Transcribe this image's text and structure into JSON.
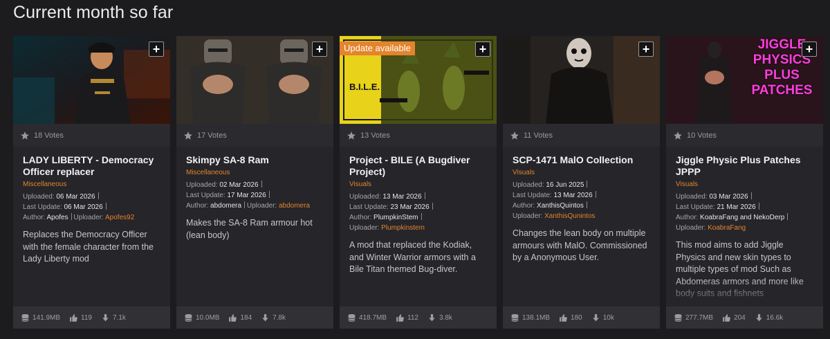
{
  "section": {
    "title": "Current month so far"
  },
  "cards": [
    {
      "votes": "18 Votes",
      "title": "LADY LIBERTY - Democracy Officer replacer",
      "category": "Miscellaneous",
      "uploaded_label": "Uploaded:",
      "uploaded": "06 Mar 2026",
      "updated_label": "Last Update:",
      "updated": "06 Mar 2026",
      "author_label": "Author:",
      "author": "Apofes",
      "uploader_label": "Uploader:",
      "uploader": "Apofes92",
      "description": "Replaces the Democracy Officer with the female character from the Lady Liberty mod",
      "size": "141.9MB",
      "likes": "119",
      "downloads": "7.1k",
      "plus": "+"
    },
    {
      "votes": "17 Votes",
      "title": "Skimpy SA-8 Ram",
      "category": "Miscellaneous",
      "uploaded_label": "Uploaded:",
      "uploaded": "02 Mar 2026",
      "updated_label": "Last Update:",
      "updated": "17 Mar 2026",
      "author_label": "Author:",
      "author": "abdomera",
      "uploader_label": "Uploader:",
      "uploader": "abdomera",
      "description": "Makes the SA-8 Ram armour hot (lean body)",
      "size": "10.0MB",
      "likes": "184",
      "downloads": "7.8k",
      "plus": "+"
    },
    {
      "votes": "13 Votes",
      "badge": "Update available",
      "thumb_text": "B.I.L.E.",
      "title": "Project - BILE (A Bugdiver Project)",
      "category": "Visuals",
      "uploaded_label": "Uploaded:",
      "uploaded": "13 Mar 2026",
      "updated_label": "Last Update:",
      "updated": "23 Mar 2026",
      "author_label": "Author:",
      "author": "PlumpkinStem",
      "uploader_label": "Uploader:",
      "uploader": "Plumpkinstem",
      "description": "A mod that replaced the Kodiak, and Winter Warrior armors with a Bile Titan themed Bug-diver.",
      "size": "418.7MB",
      "likes": "112",
      "downloads": "3.8k",
      "plus": "+"
    },
    {
      "votes": "11 Votes",
      "title": "SCP-1471 MalO Collection",
      "category": "Visuals",
      "uploaded_label": "Uploaded:",
      "uploaded": "16 Jun 2025",
      "updated_label": "Last Update:",
      "updated": "13 Mar 2026",
      "author_label": "Author:",
      "author": "XanthisQuintos",
      "uploader_label": "Uploader:",
      "uploader": "XanthisQunintos",
      "description": "Changes the lean body on multiple armours with MalO. Commissioned by a Anonymous User.",
      "size": "138.1MB",
      "likes": "180",
      "downloads": "10k",
      "plus": "+"
    },
    {
      "votes": "10 Votes",
      "thumb_text": "JIGGLE PHYSICS PLUS PATCHES",
      "title": "Jiggle Physic Plus Patches JPPP",
      "category": "Visuals",
      "uploaded_label": "Uploaded:",
      "uploaded": "03 Mar 2026",
      "updated_label": "Last Update:",
      "updated": "21 Mar 2026",
      "author_label": "Author:",
      "author": "KoabraFang and NekoDerp",
      "uploader_label": "Uploader:",
      "uploader": "KoabraFang",
      "description": "This mod aims to add Jiggle Physics and new skin types to multiple types of mod Such as Abdomeras armors and more like body suits and fishnets",
      "size": "277.7MB",
      "likes": "204",
      "downloads": "16.6k",
      "plus": "+"
    }
  ],
  "colors": {
    "accent": "#e4842d",
    "card_bg": "#25252a",
    "page_bg": "#1c1c1f"
  },
  "icons": {
    "star": "star-icon",
    "size": "database-icon",
    "likes": "thumbs-up-icon",
    "downloads": "download-arrow-icon",
    "add": "plus-icon"
  }
}
